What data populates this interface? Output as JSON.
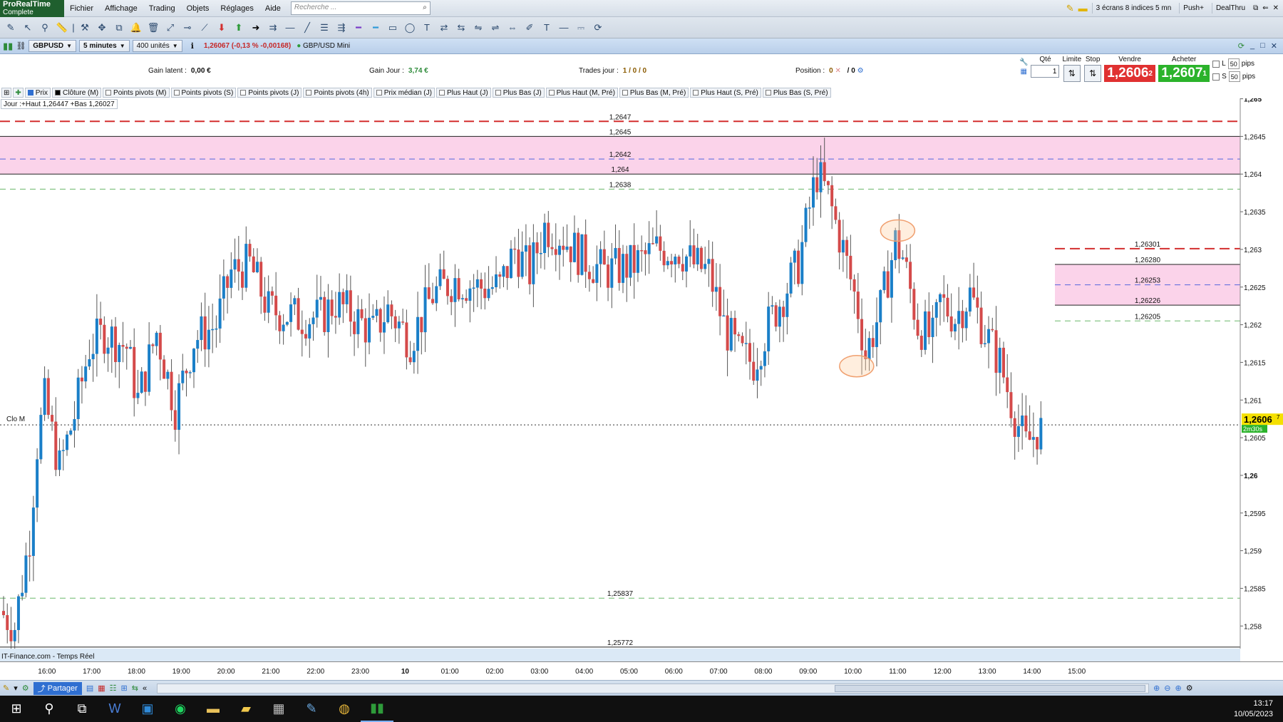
{
  "app": {
    "logo_line1": "ProRealTime",
    "logo_line2": "Complete",
    "menus": [
      "Fichier",
      "Affichage",
      "Trading",
      "Objets",
      "Réglages",
      "Aide"
    ],
    "search_placeholder": "Recherche ...",
    "layout_label": "3 écrans 8 indices 5 mn",
    "push_label": "Push+",
    "dealthru_label": "DealThru"
  },
  "instrument_bar": {
    "symbol": "GBPUSD",
    "timeframe": "5 minutes",
    "units": "400 unités",
    "quote": "1,26067 (-0,13 % -0,00168)",
    "name": "GBP/USD Mini"
  },
  "info": {
    "gain_latent_label": "Gain latent :",
    "gain_latent_value": "0,00 €",
    "gain_jour_label": "Gain Jour :",
    "gain_jour_value": "3,74 €",
    "trades_label": "Trades jour :",
    "trades_value": "1 / 0 / 0",
    "position_label": "Position :",
    "position_value": "0",
    "position_extra": "/ 0"
  },
  "order_panel": {
    "qty_label": "Qté",
    "qty_value": "1",
    "limit_label": "Limite",
    "stop_label": "Stop",
    "sell_label": "Vendre",
    "sell_price": "1,2606",
    "sell_sup": "2",
    "buy_label": "Acheter",
    "buy_price": "1,2607",
    "buy_sup": "1",
    "l_label": "L",
    "s_label": "S",
    "pips_value": "50",
    "pips_label": "pips"
  },
  "indicators": [
    "Prix",
    "Clôture (M)",
    "Points pivots (M)",
    "Points pivots (S)",
    "Points pivots (J)",
    "Points pivots (4h)",
    "Prix médian (J)",
    "Plus Haut (J)",
    "Plus Bas (J)",
    "Plus Haut (M, Pré)",
    "Plus Bas (M, Pré)",
    "Plus Haut (S, Pré)",
    "Plus Bas (S, Pré)"
  ],
  "day_box": "Jour :+Haut 1,26447 +Bas 1,26027",
  "chart_data": {
    "type": "candlestick",
    "source_label": "IT-Finance.com - Temps Réel",
    "clo_m_label": "Clo M",
    "current_price": "1,2606",
    "current_price_sup": "7",
    "countdown": "2m30s",
    "ylim": [
      1.2577,
      1.2651
    ],
    "y_ticks": [
      {
        "v": 1.265,
        "label": "1,265"
      },
      {
        "v": 1.2645,
        "label": "1,2645"
      },
      {
        "v": 1.264,
        "label": "1,264"
      },
      {
        "v": 1.2635,
        "label": "1,2635"
      },
      {
        "v": 1.263,
        "label": "1,263"
      },
      {
        "v": 1.2625,
        "label": "1,2625"
      },
      {
        "v": 1.262,
        "label": "1,262"
      },
      {
        "v": 1.2615,
        "label": "1,2615"
      },
      {
        "v": 1.261,
        "label": "1,261"
      },
      {
        "v": 1.2605,
        "label": "1,2605"
      },
      {
        "v": 1.26,
        "label": "1,26"
      },
      {
        "v": 1.2595,
        "label": "1,2595"
      },
      {
        "v": 1.259,
        "label": "1,259"
      },
      {
        "v": 1.2585,
        "label": "1,2585"
      },
      {
        "v": 1.258,
        "label": "1,258"
      }
    ],
    "x_ticks": [
      {
        "i": 12,
        "label": "16:00"
      },
      {
        "i": 24,
        "label": "17:00"
      },
      {
        "i": 36,
        "label": "18:00"
      },
      {
        "i": 48,
        "label": "19:00"
      },
      {
        "i": 60,
        "label": "20:00"
      },
      {
        "i": 72,
        "label": "21:00"
      },
      {
        "i": 84,
        "label": "22:00"
      },
      {
        "i": 96,
        "label": "23:00"
      },
      {
        "i": 108,
        "label": "10"
      },
      {
        "i": 120,
        "label": "01:00"
      },
      {
        "i": 132,
        "label": "02:00"
      },
      {
        "i": 144,
        "label": "03:00"
      },
      {
        "i": 156,
        "label": "04:00"
      },
      {
        "i": 168,
        "label": "05:00"
      },
      {
        "i": 180,
        "label": "06:00"
      },
      {
        "i": 192,
        "label": "07:00"
      },
      {
        "i": 204,
        "label": "08:00"
      },
      {
        "i": 216,
        "label": "09:00"
      },
      {
        "i": 228,
        "label": "10:00"
      },
      {
        "i": 240,
        "label": "11:00"
      },
      {
        "i": 252,
        "label": "12:00"
      },
      {
        "i": 264,
        "label": "13:00"
      },
      {
        "i": 276,
        "label": "14:00"
      },
      {
        "i": 288,
        "label": "15:00"
      }
    ],
    "anchors": [
      [
        0,
        1.2582
      ],
      [
        4,
        1.258
      ],
      [
        8,
        1.2592
      ],
      [
        10,
        1.2604
      ],
      [
        12,
        1.261
      ],
      [
        16,
        1.2601
      ],
      [
        20,
        1.2608
      ],
      [
        24,
        1.2617
      ],
      [
        28,
        1.2619
      ],
      [
        34,
        1.2617
      ],
      [
        37,
        1.261
      ],
      [
        42,
        1.2619
      ],
      [
        47,
        1.2609
      ],
      [
        52,
        1.2618
      ],
      [
        58,
        1.262
      ],
      [
        62,
        1.2627
      ],
      [
        67,
        1.2628
      ],
      [
        72,
        1.2622
      ],
      [
        80,
        1.2621
      ],
      [
        86,
        1.2621
      ],
      [
        90,
        1.2623
      ],
      [
        100,
        1.2619
      ],
      [
        104,
        1.2622
      ],
      [
        110,
        1.2618
      ],
      [
        116,
        1.2624
      ],
      [
        122,
        1.2626
      ],
      [
        128,
        1.2625
      ],
      [
        134,
        1.2625
      ],
      [
        138,
        1.263
      ],
      [
        142,
        1.2627
      ],
      [
        146,
        1.2633
      ],
      [
        150,
        1.2632
      ],
      [
        156,
        1.2629
      ],
      [
        162,
        1.2627
      ],
      [
        170,
        1.2628
      ],
      [
        176,
        1.263
      ],
      [
        182,
        1.263
      ],
      [
        186,
        1.2628
      ],
      [
        190,
        1.2627
      ],
      [
        194,
        1.262
      ],
      [
        198,
        1.2616
      ],
      [
        202,
        1.2615
      ],
      [
        206,
        1.262
      ],
      [
        210,
        1.2624
      ],
      [
        214,
        1.2628
      ],
      [
        218,
        1.2638
      ],
      [
        219,
        1.264
      ],
      [
        222,
        1.2637
      ],
      [
        226,
        1.263
      ],
      [
        230,
        1.2622
      ],
      [
        232,
        1.2616
      ],
      [
        236,
        1.2622
      ],
      [
        240,
        1.2631
      ],
      [
        242,
        1.2629
      ],
      [
        246,
        1.262
      ],
      [
        250,
        1.2618
      ],
      [
        252,
        1.2623
      ],
      [
        256,
        1.2621
      ],
      [
        260,
        1.2624
      ],
      [
        264,
        1.2619
      ],
      [
        268,
        1.2615
      ],
      [
        272,
        1.2608
      ],
      [
        275,
        1.2604
      ],
      [
        278,
        1.2606
      ]
    ],
    "levels": [
      {
        "v": 1.2647,
        "label": "1,2647",
        "color": "#d32f2f",
        "dash": "14,7",
        "x0": 0,
        "x1": 1740
      },
      {
        "v": 1.2645,
        "label": "1,2645",
        "color": "#222222",
        "dash": "",
        "x0": 0,
        "x1": 1740
      },
      {
        "v": 1.2642,
        "label": "1,2642",
        "color": "#5566dd",
        "dash": "8,6",
        "x0": 0,
        "x1": 1740
      },
      {
        "v": 1.264,
        "label": "1,264",
        "color": "#222222",
        "dash": "",
        "x0": 0,
        "x1": 1740
      },
      {
        "v": 1.2638,
        "label": "1,2638",
        "color": "#6ab86a",
        "dash": "8,6",
        "x0": 0,
        "x1": 1740
      },
      {
        "v": 1.25837,
        "label": "1,25837",
        "color": "#6ab86a",
        "dash": "8,6",
        "x0": 0,
        "x1": 1740
      },
      {
        "v": 1.25772,
        "label": "1,25772",
        "color": "#222222",
        "dash": "",
        "x0": 0,
        "x1": 1740
      },
      {
        "v": 1.26301,
        "label": "1,26301",
        "color": "#d32f2f",
        "dash": "14,7",
        "x0": 1480,
        "x1": 1740
      },
      {
        "v": 1.2628,
        "label": "1,26280",
        "color": "#222222",
        "dash": "",
        "x0": 1480,
        "x1": 1740
      },
      {
        "v": 1.26253,
        "label": "1,26253",
        "color": "#5566dd",
        "dash": "8,6",
        "x0": 1480,
        "x1": 1740
      },
      {
        "v": 1.26226,
        "label": "1,26226",
        "color": "#222222",
        "dash": "",
        "x0": 1480,
        "x1": 1740
      },
      {
        "v": 1.26205,
        "label": "1,26205",
        "color": "#6ab86a",
        "dash": "8,6",
        "x0": 1480,
        "x1": 1740
      }
    ],
    "zones": [
      {
        "top": 1.2645,
        "bottom": 1.264,
        "x0": 0,
        "x1": 1740
      },
      {
        "top": 1.2628,
        "bottom": 1.26226,
        "x0": 1480,
        "x1": 1740
      }
    ],
    "clo_m_value": 1.26067,
    "ellipses": [
      {
        "i": 240,
        "v": 1.26325
      },
      {
        "i": 229,
        "v": 1.26145
      }
    ]
  },
  "taskbar": {
    "time": "13:17",
    "date": "10/05/2023"
  }
}
